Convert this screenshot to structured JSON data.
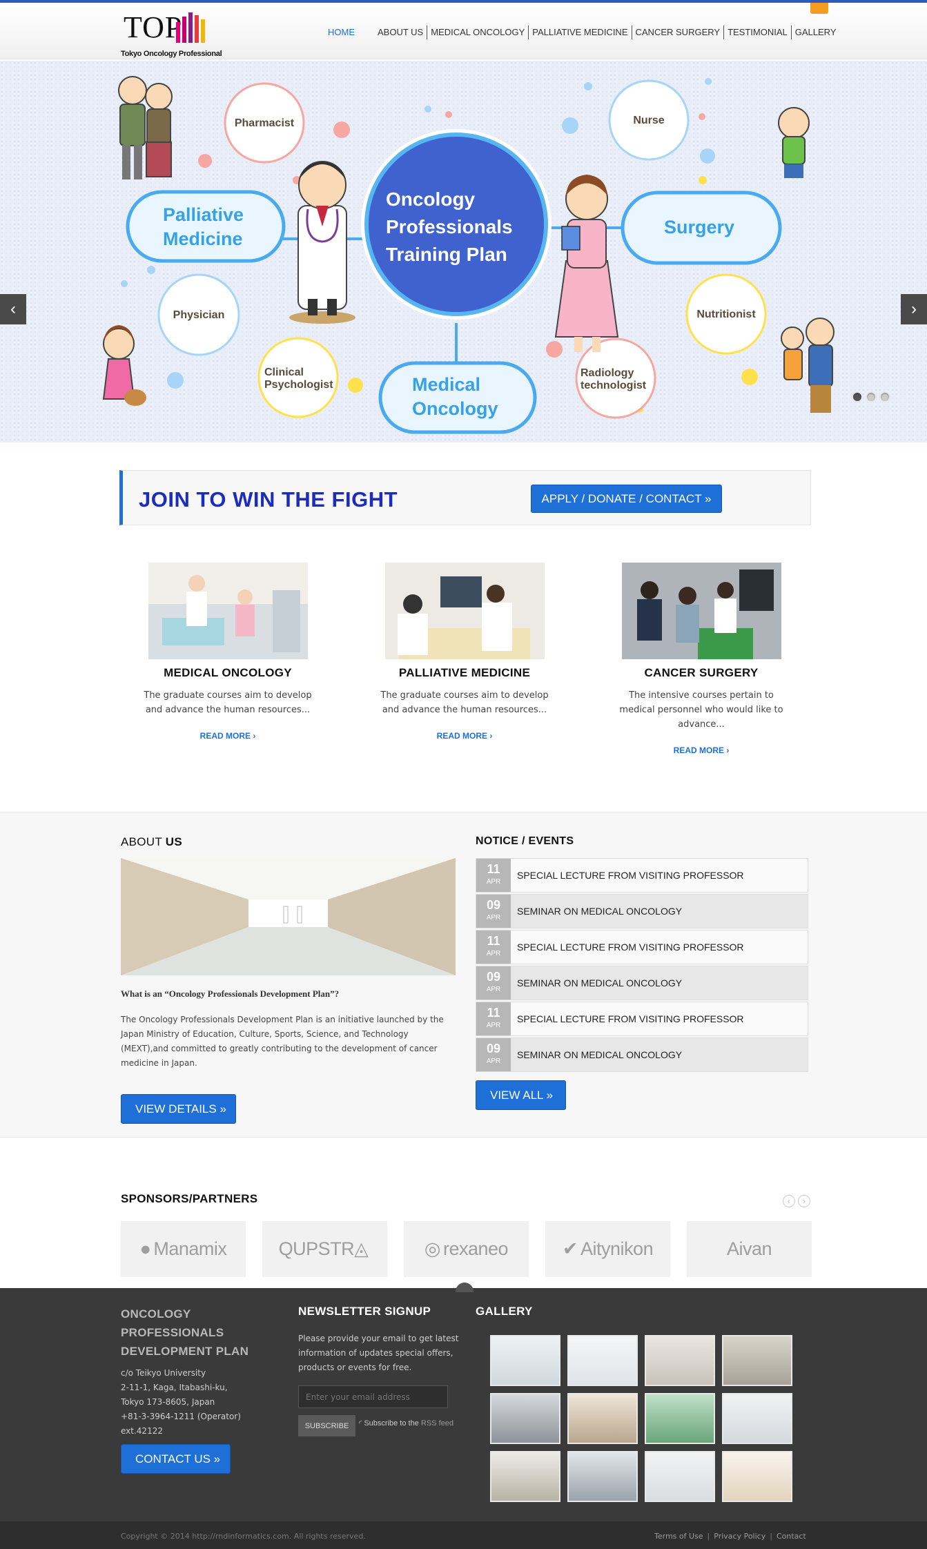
{
  "colors": {
    "accent": "#1e6fd8",
    "join_title": "#1c2db8",
    "footer_bg": "#3a3a3a",
    "hero_bg": "#e9eef8"
  },
  "logo": {
    "text": "TOP",
    "subtitle": "Tokyo Oncology Professional"
  },
  "nav": {
    "items": [
      "HOME",
      "ABOUT US",
      "MEDICAL ONCOLOGY",
      "PALLIATIVE MEDICINE",
      "CANCER SURGERY",
      "TESTIMONIAL",
      "GALLERY"
    ]
  },
  "hero": {
    "center": [
      "Oncology",
      "Professionals",
      "Training Plan"
    ],
    "palliative": [
      "Palliative",
      "Medicine"
    ],
    "surgery": "Surgery",
    "medical": [
      "Medical",
      "Oncology"
    ],
    "pharmacist": "Pharmacist",
    "nurse": "Nurse",
    "physician": "Physician",
    "nutritionist": "Nutritionist",
    "psychologist": [
      "Clinical",
      "Psychologist"
    ],
    "radiology": [
      "Radiology",
      "technologist"
    ],
    "prev_icon": "chevron-left-icon",
    "next_icon": "chevron-right-icon",
    "slide_count": 3,
    "active_slide": 1
  },
  "join": {
    "title": "JOIN TO WIN THE FIGHT",
    "button": "APPLY / DONATE / CONTACT"
  },
  "features": [
    {
      "title": "MEDICAL ONCOLOGY",
      "text": "The graduate courses aim to develop and advance the human resources...",
      "link": "READ MORE"
    },
    {
      "title": "PALLIATIVE MEDICINE",
      "text": "The graduate courses aim to develop and advance the human resources...",
      "link": "READ MORE"
    },
    {
      "title": "CANCER SURGERY",
      "text": "The intensive courses pertain to medical personnel who would like to advance...",
      "link": "READ MORE"
    }
  ],
  "about": {
    "title_plain": "ABOUT ",
    "title_bold": "US",
    "question": "What is an “Oncology Professionals Development Plan”?",
    "text": "The Oncology Professionals Development Plan is an initiative launched by the Japan Ministry of Education, Culture, Sports, Science, and Technology (MEXT),and committed to greatly contributing to the development of cancer medicine in Japan.",
    "button": "VIEW DETAILS"
  },
  "notice": {
    "title": "NOTICE / EVENTS",
    "events": [
      {
        "day": "11",
        "month": "APR",
        "title": "SPECIAL LECTURE FROM VISITING PROFESSOR"
      },
      {
        "day": "09",
        "month": "APR",
        "title": "SEMINAR ON MEDICAL ONCOLOGY"
      },
      {
        "day": "11",
        "month": "APR",
        "title": "SPECIAL LECTURE FROM VISITING PROFESSOR"
      },
      {
        "day": "09",
        "month": "APR",
        "title": "SEMINAR ON MEDICAL ONCOLOGY"
      },
      {
        "day": "11",
        "month": "APR",
        "title": "SPECIAL LECTURE FROM VISITING PROFESSOR"
      },
      {
        "day": "09",
        "month": "APR",
        "title": "SEMINAR ON MEDICAL ONCOLOGY"
      }
    ],
    "button": "VIEW ALL"
  },
  "sponsors": {
    "title": "SPONSORS/PARTNERS",
    "items": [
      "Manamix",
      "QUPSTR",
      "rexaneo",
      "Aitynikon",
      "Aivan"
    ]
  },
  "footer": {
    "org_title": "ONCOLOGY PROFESSIONALS DEVELOPMENT PLAN",
    "address": [
      "c/o Teikyo University",
      "2-11-1, Kaga, Itabashi-ku,",
      "Tokyo 173-8605, Japan",
      "+81-3-3964-1211 (Operator)",
      "ext.42122"
    ],
    "contact_button": "CONTACT US",
    "newsletter_title": "NEWSLETTER SIGNUP",
    "newsletter_text": "Please provide your email to get latest information of updates special offers, products or events for free.",
    "email_placeholder": "Enter your email address",
    "subscribe": "SUBSCRIBE",
    "rss_prefix": "Subscribe to the ",
    "rss_link": "RSS feed",
    "gallery_title": "GALLERY",
    "copyright": "Copyright © 2014 http://rndinformatics.com. All rights reserved.",
    "links": [
      "Terms of Use",
      "Privacy Policy",
      "Contact"
    ]
  }
}
